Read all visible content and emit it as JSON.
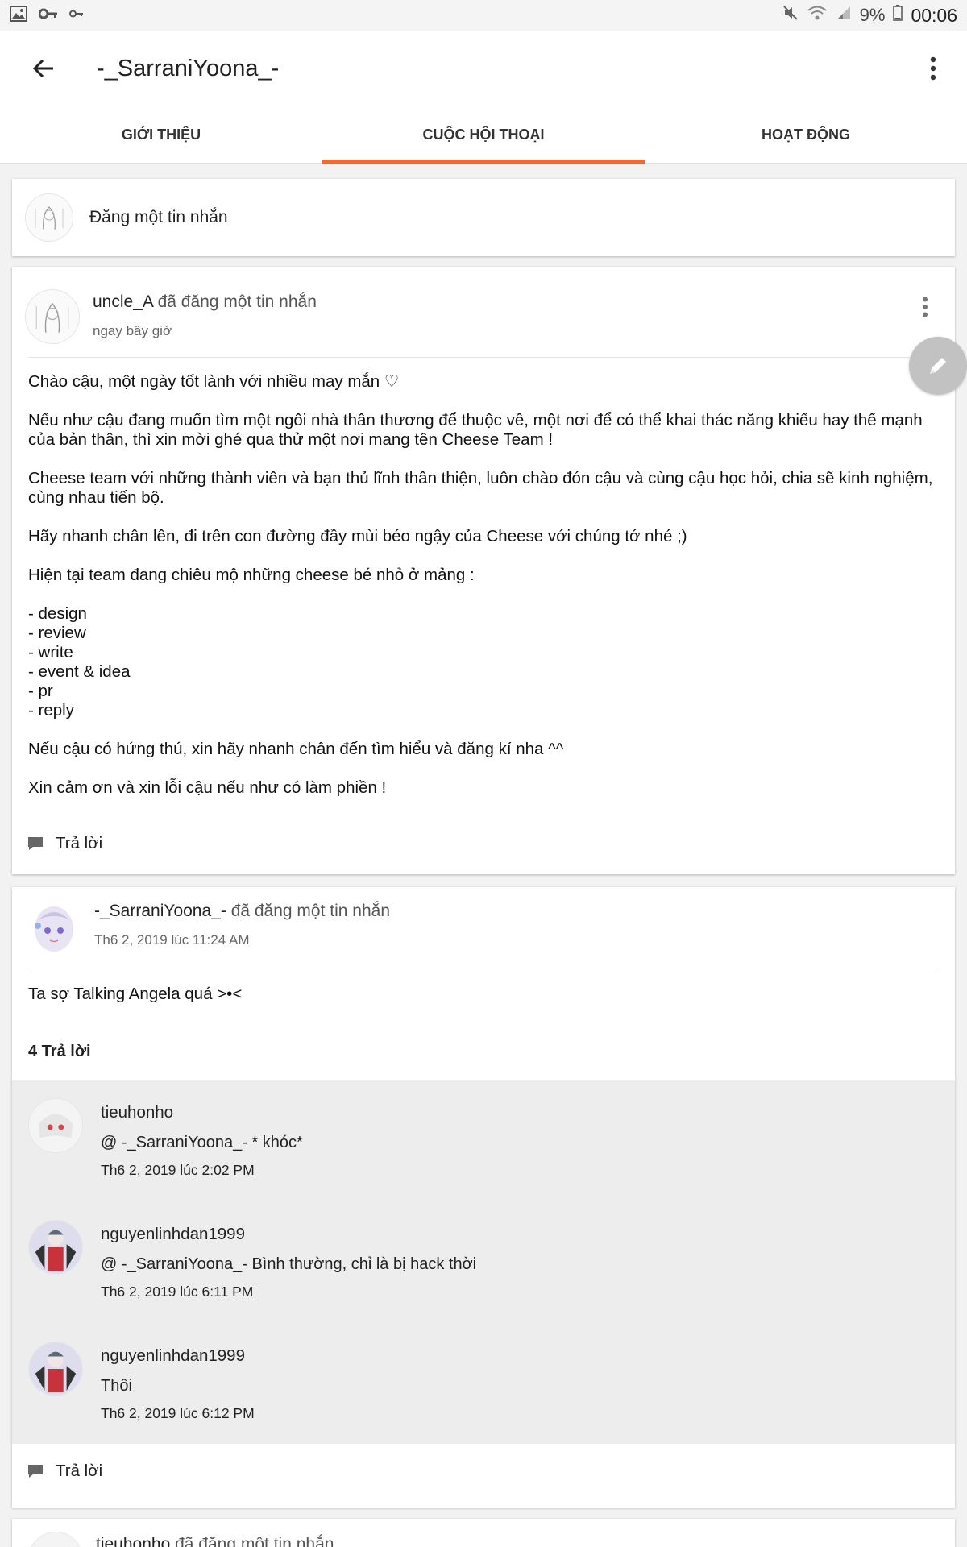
{
  "status_bar": {
    "left_icons": [
      "image-icon",
      "key-icon",
      "key-small-icon"
    ],
    "right_icons": [
      "mute-icon",
      "wifi-icon",
      "signal-icon",
      "battery-icon"
    ],
    "battery": "9%",
    "time": "00:06"
  },
  "app_bar": {
    "title": "-_SarraniYoona_-"
  },
  "tabs": [
    {
      "label": "GIỚI THIỆU",
      "active": false
    },
    {
      "label": "CUỘC HỘI THOẠI",
      "active": true
    },
    {
      "label": "HOẠT ĐỘNG",
      "active": false
    }
  ],
  "composer": {
    "placeholder": "Đăng một tin nhắn"
  },
  "posts": [
    {
      "author": "uncle_A",
      "action": "đã đăng một tin nhắn",
      "time": "ngay bây giờ",
      "body": [
        "Chào cậu, một ngày tốt lành với nhiều may mắn ♡",
        "",
        "Nếu như cậu đang muốn tìm một ngôi nhà thân thương để thuộc về, một nơi để có thể khai thác năng khiếu hay thế mạnh của bản thân, thì xin mời ghé qua thử một nơi mang tên Cheese Team !",
        "",
        "Cheese team với những thành viên và bạn thủ lĩnh thân thiện, luôn chào đón cậu và cùng cậu học hỏi, chia sẽ kinh nghiệm, cùng nhau tiến bộ.",
        "",
        "Hãy nhanh chân lên, đi trên con đường đầy mùi béo ngậy của Cheese với chúng tớ nhé ;)",
        "",
        "Hiện tại team đang chiêu mộ những cheese bé nhỏ ở mảng :",
        "",
        "- design",
        "- review",
        "- write",
        "- event & idea",
        "- pr",
        "- reply",
        "",
        "Nếu cậu có hứng thú, xin hãy nhanh chân đến tìm hiểu và đăng kí nha ^^",
        "",
        "Xin cảm ơn và xin lỗi cậu nếu như có làm phiền !"
      ],
      "reply_label": "Trả lời"
    },
    {
      "author": "-_SarraniYoona_-",
      "action": "đã đăng một tin nhắn",
      "time": "Th6 2, 2019 lúc 11:24 AM",
      "body": [
        "Ta sợ Talking Angela quá >•<"
      ],
      "replies_count": "4 Trả lời",
      "replies": [
        {
          "name": "tieuhonho",
          "mention": "@ -_SarraniYoona_-",
          "text": " * khóc*",
          "time": "Th6 2, 2019 lúc 2:02 PM"
        },
        {
          "name": "nguyenlinhdan1999",
          "mention": "@ -_SarraniYoona_-",
          "text": " Bình thường, chỉ là bị hack thời",
          "time": "Th6 2, 2019 lúc 6:11 PM"
        },
        {
          "name": "nguyenlinhdan1999",
          "mention": "",
          "text": "Thôi",
          "time": "Th6 2, 2019 lúc 6:12 PM"
        }
      ],
      "reply_label": "Trả lời"
    },
    {
      "author": "tieuhonho",
      "action": "đã đăng một tin nhắn"
    }
  ],
  "colors": {
    "accent": "#ee6a36",
    "fab": "#c2c2c2",
    "reply_bg": "#ededed"
  }
}
